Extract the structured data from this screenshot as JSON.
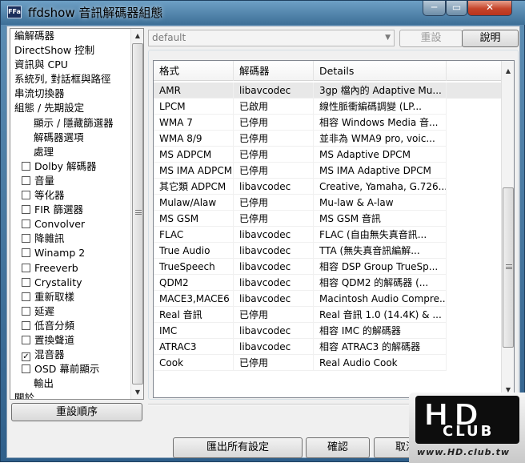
{
  "window": {
    "title": "ffdshow 音訊解碼器組態",
    "icon_label": "FFa",
    "minimize_glyph": "─",
    "maximize_glyph": "▭",
    "close_glyph": "✕"
  },
  "tree": {
    "items": [
      {
        "label": "編解碼器",
        "type": "top"
      },
      {
        "label": "DirectShow 控制",
        "type": "top"
      },
      {
        "label": "資訊與 CPU",
        "type": "top"
      },
      {
        "label": "系統列, 對話框與路徑",
        "type": "top"
      },
      {
        "label": "串流切換器",
        "type": "top"
      },
      {
        "label": "組態 / 先期設定",
        "type": "top"
      },
      {
        "label": "顯示 / 隱藏篩選器",
        "type": "sub"
      },
      {
        "label": "解碼器選項",
        "type": "sub"
      },
      {
        "label": "處理",
        "type": "sub"
      },
      {
        "label": "Dolby 解碼器",
        "type": "check",
        "checked": false
      },
      {
        "label": "音量",
        "type": "check",
        "checked": false
      },
      {
        "label": "等化器",
        "type": "check",
        "checked": false
      },
      {
        "label": "FIR 篩選器",
        "type": "check",
        "checked": false
      },
      {
        "label": "Convolver",
        "type": "check",
        "checked": false
      },
      {
        "label": "降雜訊",
        "type": "check",
        "checked": false
      },
      {
        "label": "Winamp 2",
        "type": "check",
        "checked": false
      },
      {
        "label": "Freeverb",
        "type": "check",
        "checked": false
      },
      {
        "label": "Crystality",
        "type": "check",
        "checked": false
      },
      {
        "label": "重新取樣",
        "type": "check",
        "checked": false
      },
      {
        "label": "延遲",
        "type": "check",
        "checked": false
      },
      {
        "label": "低音分頻",
        "type": "check",
        "checked": false
      },
      {
        "label": "置換聲道",
        "type": "check",
        "checked": false
      },
      {
        "label": "混音器",
        "type": "check",
        "checked": true
      },
      {
        "label": "OSD 幕前顯示",
        "type": "check",
        "checked": false
      },
      {
        "label": "輸出",
        "type": "sub"
      },
      {
        "label": "關於",
        "type": "top"
      }
    ]
  },
  "buttons": {
    "reset_order": "重設順序",
    "reset": "重設",
    "explain": "說明",
    "export_all": "匯出所有設定",
    "ok": "確認",
    "cancel": "取消"
  },
  "preset": {
    "value": "default"
  },
  "codec_table": {
    "headers": [
      "格式",
      "解碼器",
      "Details"
    ],
    "rows": [
      [
        "AMR",
        "libavcodec",
        "3gp 檔內的 Adaptive Mu..."
      ],
      [
        "LPCM",
        "已啟用",
        "線性脈衝編碼調變 (LP..."
      ],
      [
        "WMA 7",
        "已停用",
        "相容 Windows Media 音..."
      ],
      [
        "WMA 8/9",
        "已停用",
        "並非為 WMA9 pro, voic..."
      ],
      [
        "MS ADPCM",
        "已停用",
        "MS Adaptive DPCM"
      ],
      [
        "MS IMA ADPCM",
        "已停用",
        "MS IMA Adaptive DPCM"
      ],
      [
        "其它類 ADPCM",
        "libavcodec",
        "Creative, Yamaha, G.726..."
      ],
      [
        "Mulaw/Alaw",
        "已停用",
        "Mu-law & A-law"
      ],
      [
        "MS GSM",
        "已停用",
        "MS GSM 音訊"
      ],
      [
        "FLAC",
        "libavcodec",
        "FLAC (自由無失真音訊..."
      ],
      [
        "True Audio",
        "libavcodec",
        "TTA (無失真音訊編解..."
      ],
      [
        "TrueSpeech",
        "libavcodec",
        "相容 DSP Group TrueSp..."
      ],
      [
        "QDM2",
        "libavcodec",
        "相容 QDM2 的解碼器 (..."
      ],
      [
        "MACE3,MACE6",
        "libavcodec",
        "Macintosh Audio Compre..."
      ],
      [
        "Real 音訊",
        "已停用",
        "Real 音訊 1.0 (14.4K) & ..."
      ],
      [
        "IMC",
        "libavcodec",
        "相容 IMC 的解碼器"
      ],
      [
        "ATRAC3",
        "libavcodec",
        "相容 ATRAC3 的解碼器"
      ],
      [
        "Cook",
        "已停用",
        "Real Audio Cook"
      ]
    ],
    "selected_row": 0
  },
  "watermark": {
    "logo_text": "HD",
    "logo_sub": "CLUB",
    "url": "www.HD.club.tw"
  }
}
